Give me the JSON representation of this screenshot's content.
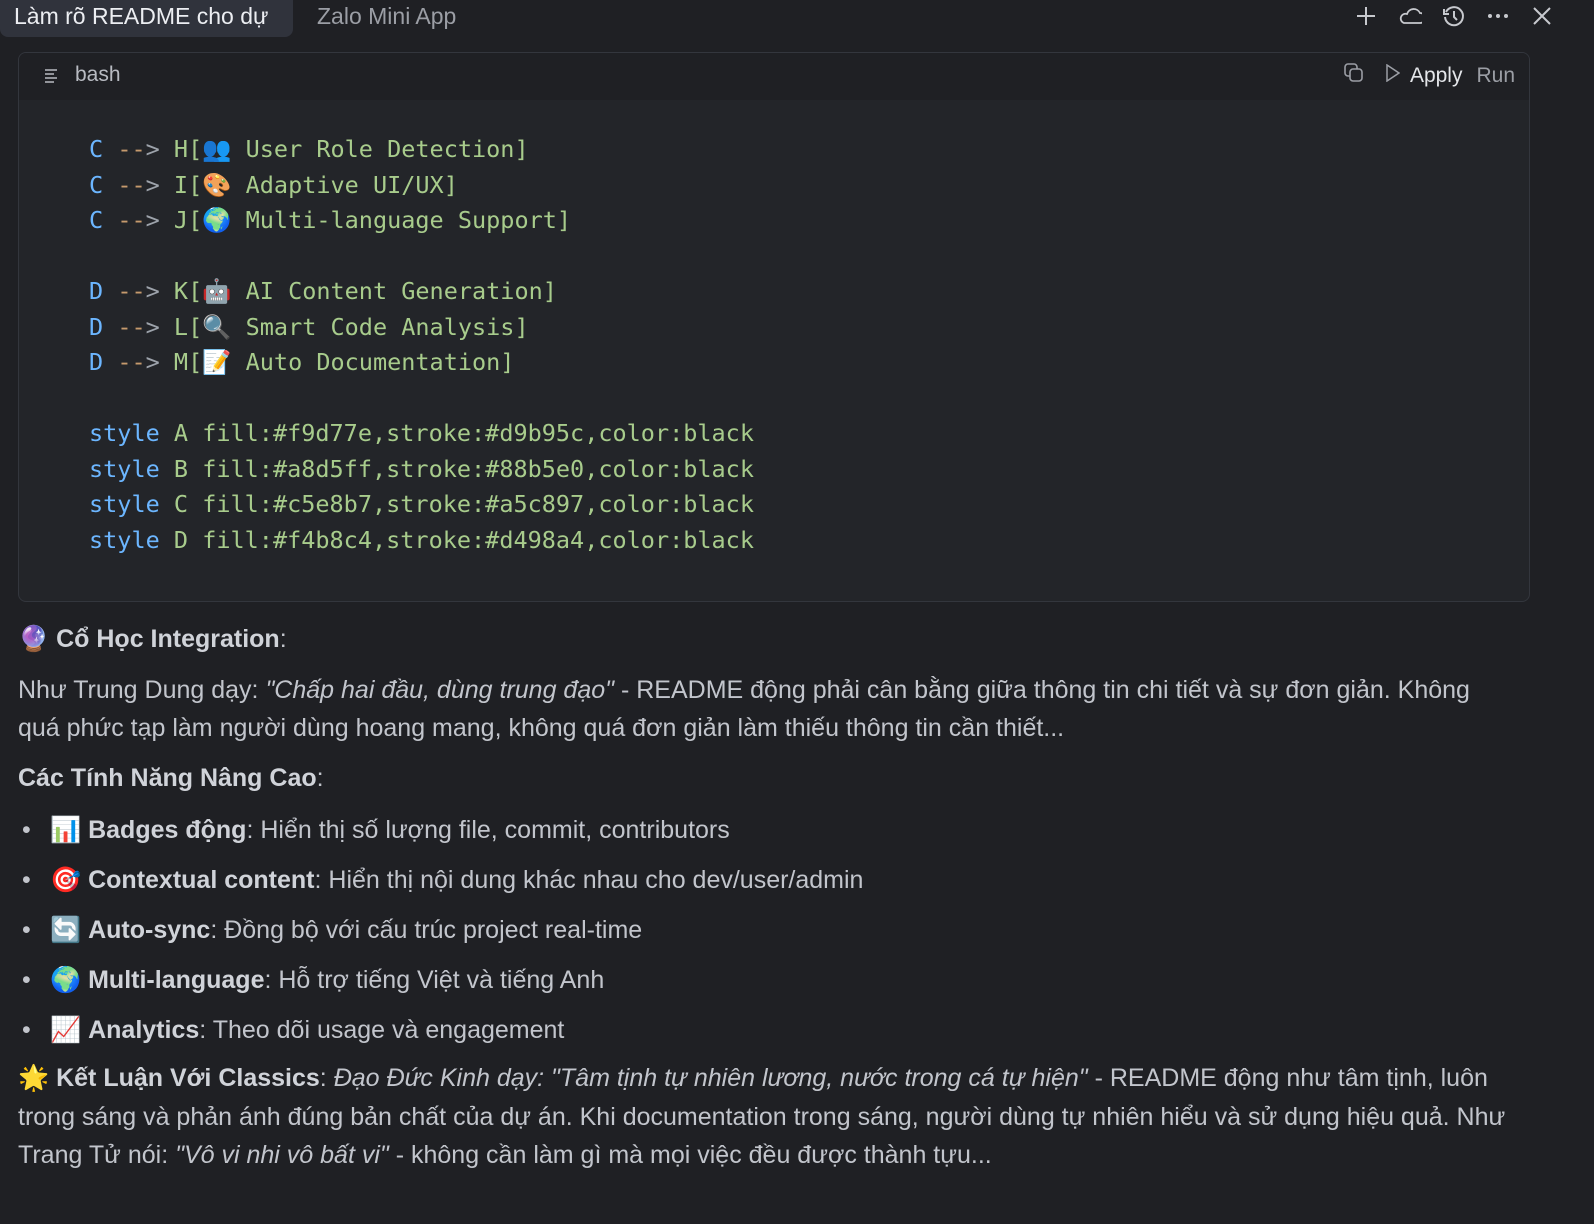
{
  "tabs": [
    {
      "label": "Làm rõ README cho dự",
      "active": true
    },
    {
      "label": "Zalo Mini App",
      "active": false
    }
  ],
  "toolbar_icons": [
    "plus-icon",
    "cloud-icon",
    "history-icon",
    "more-icon",
    "close-icon"
  ],
  "code_block": {
    "language": "bash",
    "apply_label": "Apply",
    "run_label": "Run",
    "lines": [
      {
        "kw": "C",
        "target": "H[👥 User Role Detection]"
      },
      {
        "kw": "C",
        "target": "I[🎨 Adaptive UI/UX]"
      },
      {
        "kw": "C",
        "target": "J[🌍 Multi-language Support]"
      },
      {},
      {
        "kw": "D",
        "target": "K[🤖 AI Content Generation]"
      },
      {
        "kw": "D",
        "target": "L[🔍 Smart Code Analysis]"
      },
      {
        "kw": "D",
        "target": "M[📝 Auto Documentation]"
      },
      {},
      {
        "style": "style",
        "rest": "A fill:#f9d77e,stroke:#d9b95c,color:black"
      },
      {
        "style": "style",
        "rest": "B fill:#a8d5ff,stroke:#88b5e0,color:black"
      },
      {
        "style": "style",
        "rest": "C fill:#c5e8b7,stroke:#a5c897,color:black"
      },
      {
        "style": "style",
        "rest": "D fill:#f4b8c4,stroke:#d498a4,color:black"
      }
    ]
  },
  "prose": {
    "integration_heading": {
      "emoji": "🔮",
      "bold": "Cổ Học Integration",
      "tail": ":"
    },
    "integration_para": {
      "lead": "Như Trung Dung dạy: ",
      "quote": "\"Chấp hai đầu, dùng trung đạo\"",
      "rest": " - README động phải cân bằng giữa thông tin chi tiết và sự đơn giản. Không quá phức tạp làm người dùng hoang mang, không quá đơn giản làm thiếu thông tin cần thiết..."
    },
    "features_heading": {
      "bold": "Các Tính Năng Nâng Cao",
      "tail": ":"
    },
    "features": [
      {
        "emoji": "📊",
        "bold": "Badges động",
        "text": ": Hiển thị số lượng file, commit, contributors"
      },
      {
        "emoji": "🎯",
        "bold": "Contextual content",
        "text": ": Hiển thị nội dung khác nhau cho dev/user/admin"
      },
      {
        "emoji": "🔄",
        "bold": "Auto-sync",
        "text": ": Đồng bộ với cấu trúc project real-time"
      },
      {
        "emoji": "🌍",
        "bold": "Multi-language",
        "text": ": Hỗ trợ tiếng Việt và tiếng Anh"
      },
      {
        "emoji": "📈",
        "bold": "Analytics",
        "text": ": Theo dõi usage và engagement"
      }
    ],
    "conclusion": {
      "emoji": "🌟",
      "bold": "Kết Luận Với Classics",
      "colon": ": ",
      "italic1": "Đạo Đức Kinh dạy: \"Tâm tịnh tự nhiên lương, nước trong cá tự hiện\"",
      "mid": " - README động như tâm tịnh, luôn trong sáng và phản ánh đúng bản chất của dự án. Khi documentation trong sáng, người dùng tự nhiên hiểu và sử dụng hiệu quả. Như Trang Tử nói: ",
      "italic2": "\"Vô vi nhi vô bất vi\"",
      "end": " - không cần làm gì mà mọi việc đều được thành tựu..."
    }
  }
}
